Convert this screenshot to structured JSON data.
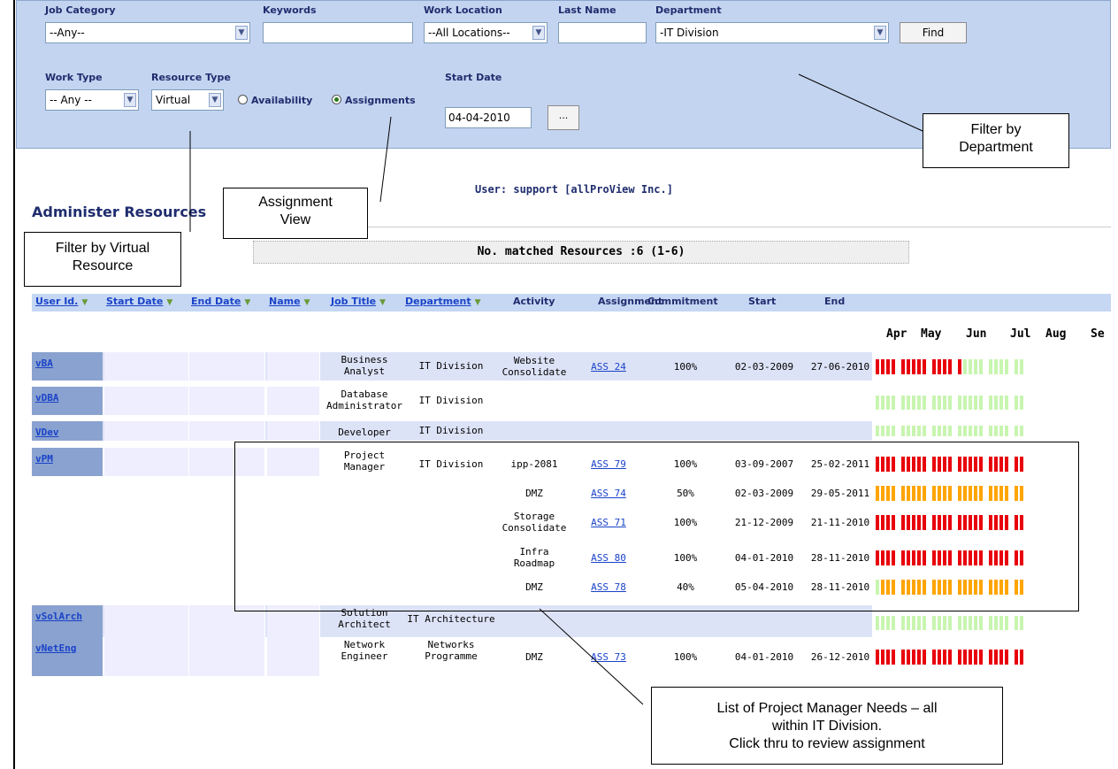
{
  "filters": {
    "job_category": {
      "label": "Job Category",
      "value": "--Any--"
    },
    "keywords": {
      "label": "Keywords",
      "value": ""
    },
    "work_location": {
      "label": "Work Location",
      "value": "--All Locations--"
    },
    "last_name": {
      "label": "Last Name",
      "value": ""
    },
    "department": {
      "label": "Department",
      "value": "-IT Division"
    },
    "find_label": "Find",
    "work_type": {
      "label": "Work Type",
      "value": "-- Any --"
    },
    "resource_type": {
      "label": "Resource Type",
      "value": "Virtual"
    },
    "view_availability": "Availability",
    "view_assignments": "Assignments",
    "selected_view": "assignments",
    "start_date": {
      "label": "Start Date",
      "value": "04-04-2010"
    },
    "date_picker_label": "..."
  },
  "page": {
    "title": "Administer Resources",
    "user_line": "User: support  [allProView Inc.]",
    "matched": "No. matched Resources :6 (1-6)"
  },
  "headers": [
    "User Id.",
    "Start Date",
    "End Date",
    "Name",
    "Job Title",
    "Department",
    "Activity",
    "Assignment",
    "Commitment",
    "Start",
    "End"
  ],
  "months": [
    "Apr",
    "May",
    "Jun",
    "Jul",
    "Aug",
    "Se"
  ],
  "resources": [
    {
      "user_id": "vBA",
      "job_title": [
        "Business",
        "Analyst"
      ],
      "department": [
        "IT Division"
      ],
      "assignments": [
        {
          "activity": [
            "Website",
            "Consolidate"
          ],
          "assignment": "ASS 24",
          "commitment": "100%",
          "start": "02-03-2009",
          "end": "27-06-2010"
        }
      ]
    },
    {
      "user_id": "vDBA",
      "job_title": [
        "Database",
        "Administrator"
      ],
      "department": [
        "IT Division"
      ],
      "assignments": []
    },
    {
      "user_id": "VDev",
      "job_title": [
        "Developer"
      ],
      "department": [
        "IT Division"
      ],
      "assignments": []
    },
    {
      "user_id": "vPM",
      "job_title": [
        "Project",
        "Manager"
      ],
      "department": [
        "IT Division"
      ],
      "assignments": [
        {
          "activity": [
            "ipp-2081"
          ],
          "assignment": "ASS 79",
          "commitment": "100%",
          "start": "03-09-2007",
          "end": "25-02-2011"
        },
        {
          "activity": [
            "DMZ"
          ],
          "assignment": "ASS 74",
          "commitment": "50%",
          "start": "02-03-2009",
          "end": "29-05-2011"
        },
        {
          "activity": [
            "Storage",
            "Consolidate"
          ],
          "assignment": "ASS 71",
          "commitment": "100%",
          "start": "21-12-2009",
          "end": "21-11-2010"
        },
        {
          "activity": [
            "Infra",
            "Roadmap"
          ],
          "assignment": "ASS 80",
          "commitment": "100%",
          "start": "04-01-2010",
          "end": "28-11-2010"
        },
        {
          "activity": [
            "DMZ"
          ],
          "assignment": "ASS 78",
          "commitment": "40%",
          "start": "05-04-2010",
          "end": "28-11-2010"
        }
      ]
    },
    {
      "user_id": "vSolArch",
      "job_title": [
        "Solution",
        "Architect"
      ],
      "department": [
        "IT Architecture"
      ],
      "assignments": []
    },
    {
      "user_id": "vNetEng",
      "job_title": [
        "Network",
        "Engineer"
      ],
      "department": [
        "Networks",
        "Programme"
      ],
      "assignments": [
        {
          "activity": [
            "DMZ"
          ],
          "assignment": "ASS 73",
          "commitment": "100%",
          "start": "04-01-2010",
          "end": "26-12-2010"
        }
      ]
    }
  ],
  "callouts": {
    "department": [
      "Filter by",
      "Department"
    ],
    "assignment_view": [
      "Assignment",
      "View"
    ],
    "virtual": [
      "Filter by Virtual",
      "Resource"
    ],
    "pm_needs": [
      "List of Project Manager Needs – all",
      "within IT Division.",
      "Click thru to review assignment"
    ]
  },
  "colors": {
    "panel": "#c3d4f0",
    "header": "#c5d7f3",
    "full": "#e8000b",
    "partial": "#ffa500",
    "free": "#c8f5b0",
    "link": "#1a43c9",
    "title": "#1f2d6e"
  }
}
